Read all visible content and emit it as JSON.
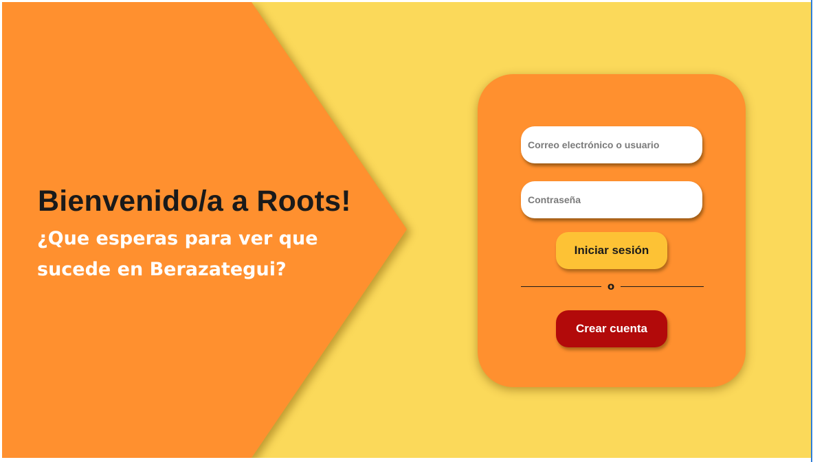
{
  "hero": {
    "title": "Bienvenido/a a Roots!",
    "subtitle": "¿Que esperas para ver que sucede en Berazategui?"
  },
  "login": {
    "user_placeholder": "Correo electrónico o usuario",
    "password_placeholder": "Contraseña",
    "login_label": "Iniciar sesión",
    "or_label": "o",
    "create_label": "Crear cuenta"
  },
  "colors": {
    "background": "#fbd95a",
    "hero_shape": "#ff902f",
    "card": "#ff902f",
    "login_button": "#fdc235",
    "create_button": "#b20a0a"
  }
}
